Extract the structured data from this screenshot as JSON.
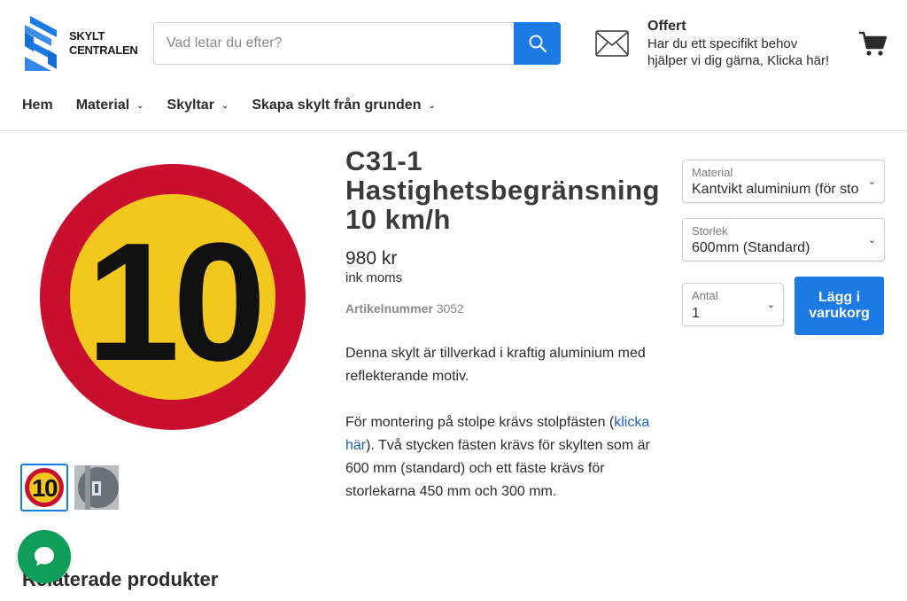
{
  "header": {
    "logo": {
      "line1": "SKYLT",
      "line2": "CENTRALEN"
    },
    "search": {
      "placeholder": "Vad letar du efter?",
      "value": ""
    },
    "offer": {
      "title": "Offert",
      "description": "Har du ett specifikt behov hjälper vi dig gärna, Klicka här!"
    }
  },
  "nav": {
    "items": [
      {
        "label": "Hem",
        "has_dropdown": false
      },
      {
        "label": "Material",
        "has_dropdown": true
      },
      {
        "label": "Skyltar",
        "has_dropdown": true
      },
      {
        "label": "Skapa skylt från grunden",
        "has_dropdown": true
      }
    ]
  },
  "product": {
    "title": "C31-1 Hastighetsbegränsning 10 km/h",
    "sign_number": "10",
    "price": "980 kr",
    "price_note": "ink moms",
    "sku_label": "Artikelnummer",
    "sku_value": "3052",
    "description_1": "Denna skylt är tillverkad i kraftig aluminium med reflekterande motiv.",
    "description_2_before": "För montering på stolpe krävs stolpfästen (",
    "description_2_link": "klicka här",
    "description_2_after": "). Två stycken fästen krävs för skylten som är 600 mm (standard) och ett fäste krävs för storlekarna 450 mm och 300 mm."
  },
  "options": {
    "material": {
      "label": "Material",
      "value": "Kantvikt aluminium (för sto"
    },
    "size": {
      "label": "Storlek",
      "value": "600mm (Standard)"
    },
    "quantity": {
      "label": "Antal",
      "value": "1"
    },
    "add_to_cart": "Lägg i varukorg"
  },
  "related": {
    "title": "Relaterade produkter"
  },
  "colors": {
    "accent": "#1c7ae4",
    "sign_red": "#c8102e",
    "sign_yellow": "#f2c81e",
    "chat_green": "#0e9e5a"
  },
  "icons": {
    "search": "search-icon",
    "offer": "envelope-icon",
    "cart": "cart-icon",
    "chat": "chat-icon",
    "chevron": "chevron-down-icon"
  }
}
